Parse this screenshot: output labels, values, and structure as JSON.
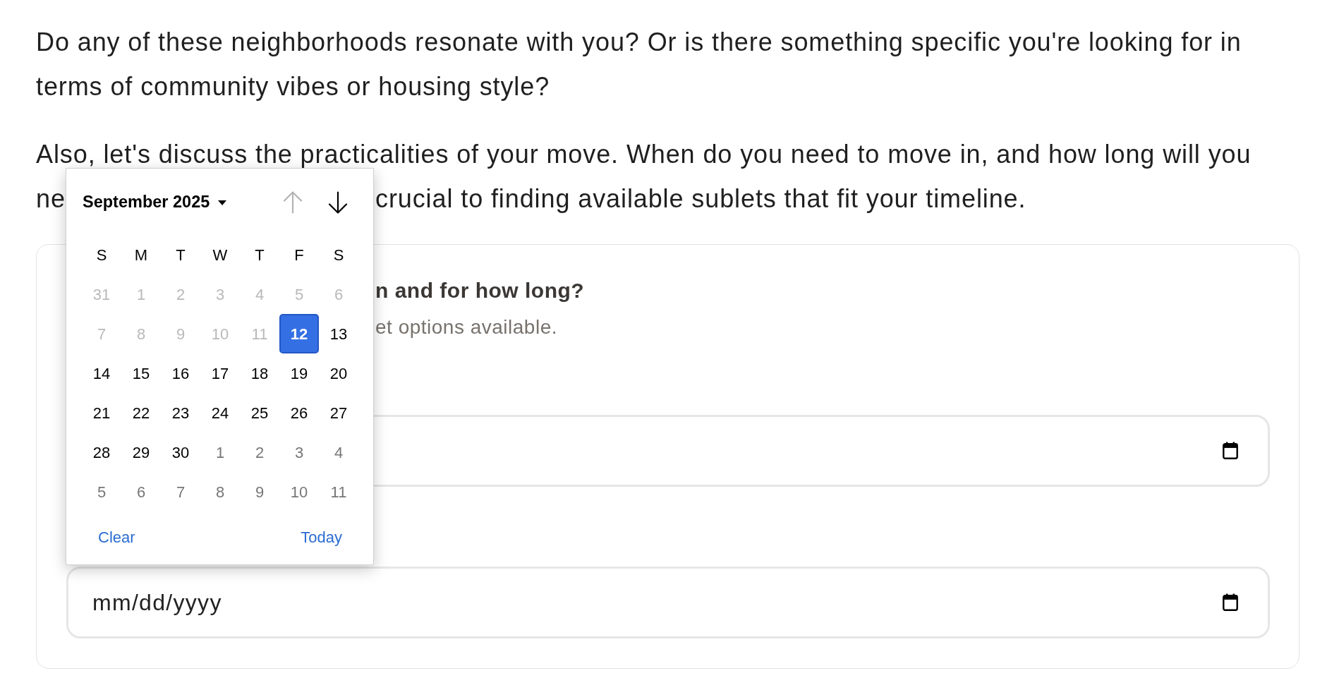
{
  "intro_paragraph": "Do any of these neighborhoods resonate with you? Or is there something specific you're looking for in terms of community vibes or housing style?",
  "timing_paragraph": {
    "line_1": "Also, let's discuss the practicalities of your move. When do you need to move in, and how long will you",
    "line_2_left": "ne",
    "line_2_right": "crucial to finding available sublets that fit your timeline."
  },
  "form_card": {
    "heading": "n and for how long?",
    "hint": "et options available.",
    "date_fields": [
      {
        "kind": "date"
      },
      {
        "kind": "date",
        "placeholder": "mm/dd/yyyy"
      }
    ]
  },
  "date_picker": {
    "month_label": "September 2025",
    "prev_button": {
      "disabled": true
    },
    "next_button": {
      "disabled": false
    },
    "weekdays": [
      "S",
      "M",
      "T",
      "W",
      "T",
      "F",
      "S"
    ],
    "days": [
      {
        "label": "31",
        "kind": "disabled",
        "selected": false
      },
      {
        "label": "1",
        "kind": "disabled",
        "selected": false
      },
      {
        "label": "2",
        "kind": "disabled",
        "selected": false
      },
      {
        "label": "3",
        "kind": "disabled",
        "selected": false
      },
      {
        "label": "4",
        "kind": "disabled",
        "selected": false
      },
      {
        "label": "5",
        "kind": "disabled",
        "selected": false
      },
      {
        "label": "6",
        "kind": "disabled",
        "selected": false
      },
      {
        "label": "7",
        "kind": "disabled",
        "selected": false
      },
      {
        "label": "8",
        "kind": "disabled",
        "selected": false
      },
      {
        "label": "9",
        "kind": "disabled",
        "selected": false
      },
      {
        "label": "10",
        "kind": "disabled",
        "selected": false
      },
      {
        "label": "11",
        "kind": "disabled",
        "selected": false
      },
      {
        "label": "12",
        "kind": "current",
        "selected": true
      },
      {
        "label": "13",
        "kind": "current",
        "selected": false
      },
      {
        "label": "14",
        "kind": "current",
        "selected": false
      },
      {
        "label": "15",
        "kind": "current",
        "selected": false
      },
      {
        "label": "16",
        "kind": "current",
        "selected": false
      },
      {
        "label": "17",
        "kind": "current",
        "selected": false
      },
      {
        "label": "18",
        "kind": "current",
        "selected": false
      },
      {
        "label": "19",
        "kind": "current",
        "selected": false
      },
      {
        "label": "20",
        "kind": "current",
        "selected": false
      },
      {
        "label": "21",
        "kind": "current",
        "selected": false
      },
      {
        "label": "22",
        "kind": "current",
        "selected": false
      },
      {
        "label": "23",
        "kind": "current",
        "selected": false
      },
      {
        "label": "24",
        "kind": "current",
        "selected": false
      },
      {
        "label": "25",
        "kind": "current",
        "selected": false
      },
      {
        "label": "26",
        "kind": "current",
        "selected": false
      },
      {
        "label": "27",
        "kind": "current",
        "selected": false
      },
      {
        "label": "28",
        "kind": "current",
        "selected": false
      },
      {
        "label": "29",
        "kind": "current",
        "selected": false
      },
      {
        "label": "30",
        "kind": "current",
        "selected": false
      },
      {
        "label": "1",
        "kind": "adjacent",
        "selected": false
      },
      {
        "label": "2",
        "kind": "adjacent",
        "selected": false
      },
      {
        "label": "3",
        "kind": "adjacent",
        "selected": false
      },
      {
        "label": "4",
        "kind": "adjacent",
        "selected": false
      },
      {
        "label": "5",
        "kind": "adjacent",
        "selected": false
      },
      {
        "label": "6",
        "kind": "adjacent",
        "selected": false
      },
      {
        "label": "7",
        "kind": "adjacent",
        "selected": false
      },
      {
        "label": "8",
        "kind": "adjacent",
        "selected": false
      },
      {
        "label": "9",
        "kind": "adjacent",
        "selected": false
      },
      {
        "label": "10",
        "kind": "adjacent",
        "selected": false
      },
      {
        "label": "11",
        "kind": "adjacent",
        "selected": false
      }
    ],
    "clear_label": "Clear",
    "today_label": "Today"
  }
}
